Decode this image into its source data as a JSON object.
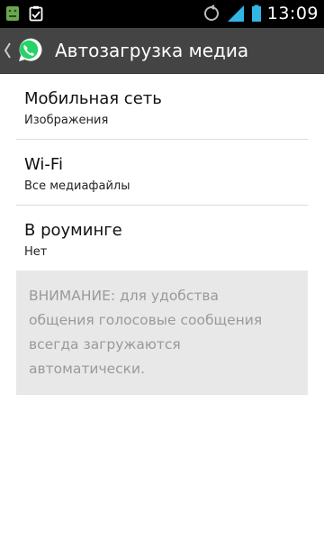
{
  "status_bar": {
    "time": "13:09",
    "icons": [
      "android-notification-icon",
      "clipboard-check-icon",
      "sync-icon",
      "signal-icon",
      "battery-icon"
    ]
  },
  "action_bar": {
    "title": "Автозагрузка медиа",
    "logo": "whatsapp-icon",
    "background": "#444444"
  },
  "settings": [
    {
      "title": "Мобильная сеть",
      "summary": "Изображения"
    },
    {
      "title": "Wi-Fi",
      "summary": "Все медиафайлы"
    },
    {
      "title": "В роуминге",
      "summary": "Нет"
    }
  ],
  "note": {
    "text": "ВНИМАНИЕ: для удобства\nобщения голосовые сообщения\nвсегда загружаются\nавтоматически."
  },
  "colors": {
    "whatsapp_green": "#25d366",
    "status_icons_blue": "#33b5e5"
  }
}
